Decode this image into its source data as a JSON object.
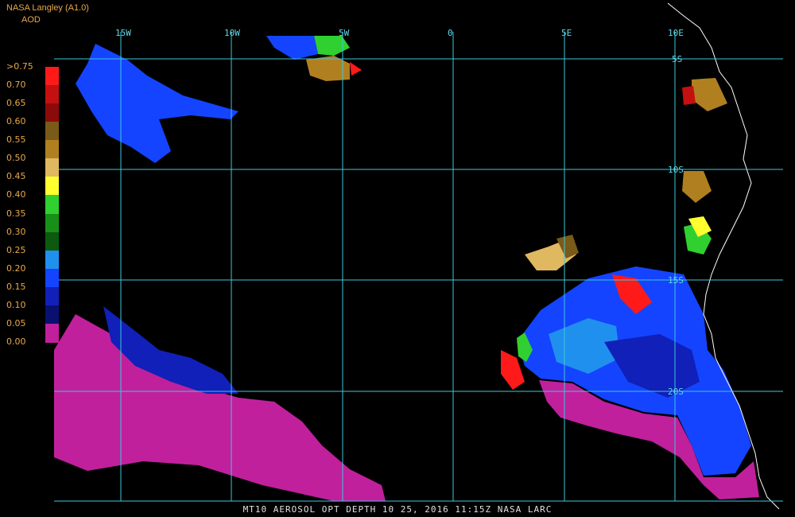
{
  "header": {
    "producer": "NASA Langley (A1.0)",
    "product": "AOD"
  },
  "legend": {
    "ticks": [
      ">0.75",
      "0.70",
      "0.65",
      "0.60",
      "0.55",
      "0.50",
      "0.45",
      "0.40",
      "0.35",
      "0.30",
      "0.25",
      "0.20",
      "0.15",
      "0.10",
      "0.05",
      "0.00"
    ],
    "colors": [
      "#ff1a1a",
      "#c41010",
      "#8c0a0a",
      "#7a5a18",
      "#b08020",
      "#e0b860",
      "#ffff30",
      "#30d030",
      "#189018",
      "#0c5a10",
      "#2090ee",
      "#1444ff",
      "#1020b8",
      "#0a1070",
      "#c0209c"
    ]
  },
  "grid": {
    "lon_labels": [
      "15W",
      "10W",
      "5W",
      "0",
      "5E",
      "10E"
    ],
    "lat_labels": [
      "5S",
      "10S",
      "15S",
      "20S"
    ]
  },
  "footer": {
    "caption": "MT10  AEROSOL OPT DEPTH   10 25, 2016 11:15Z   NASA LARC"
  },
  "colors": {
    "grid": "#3cc8dc",
    "coast": "#ffffff",
    "background": "#000000"
  }
}
